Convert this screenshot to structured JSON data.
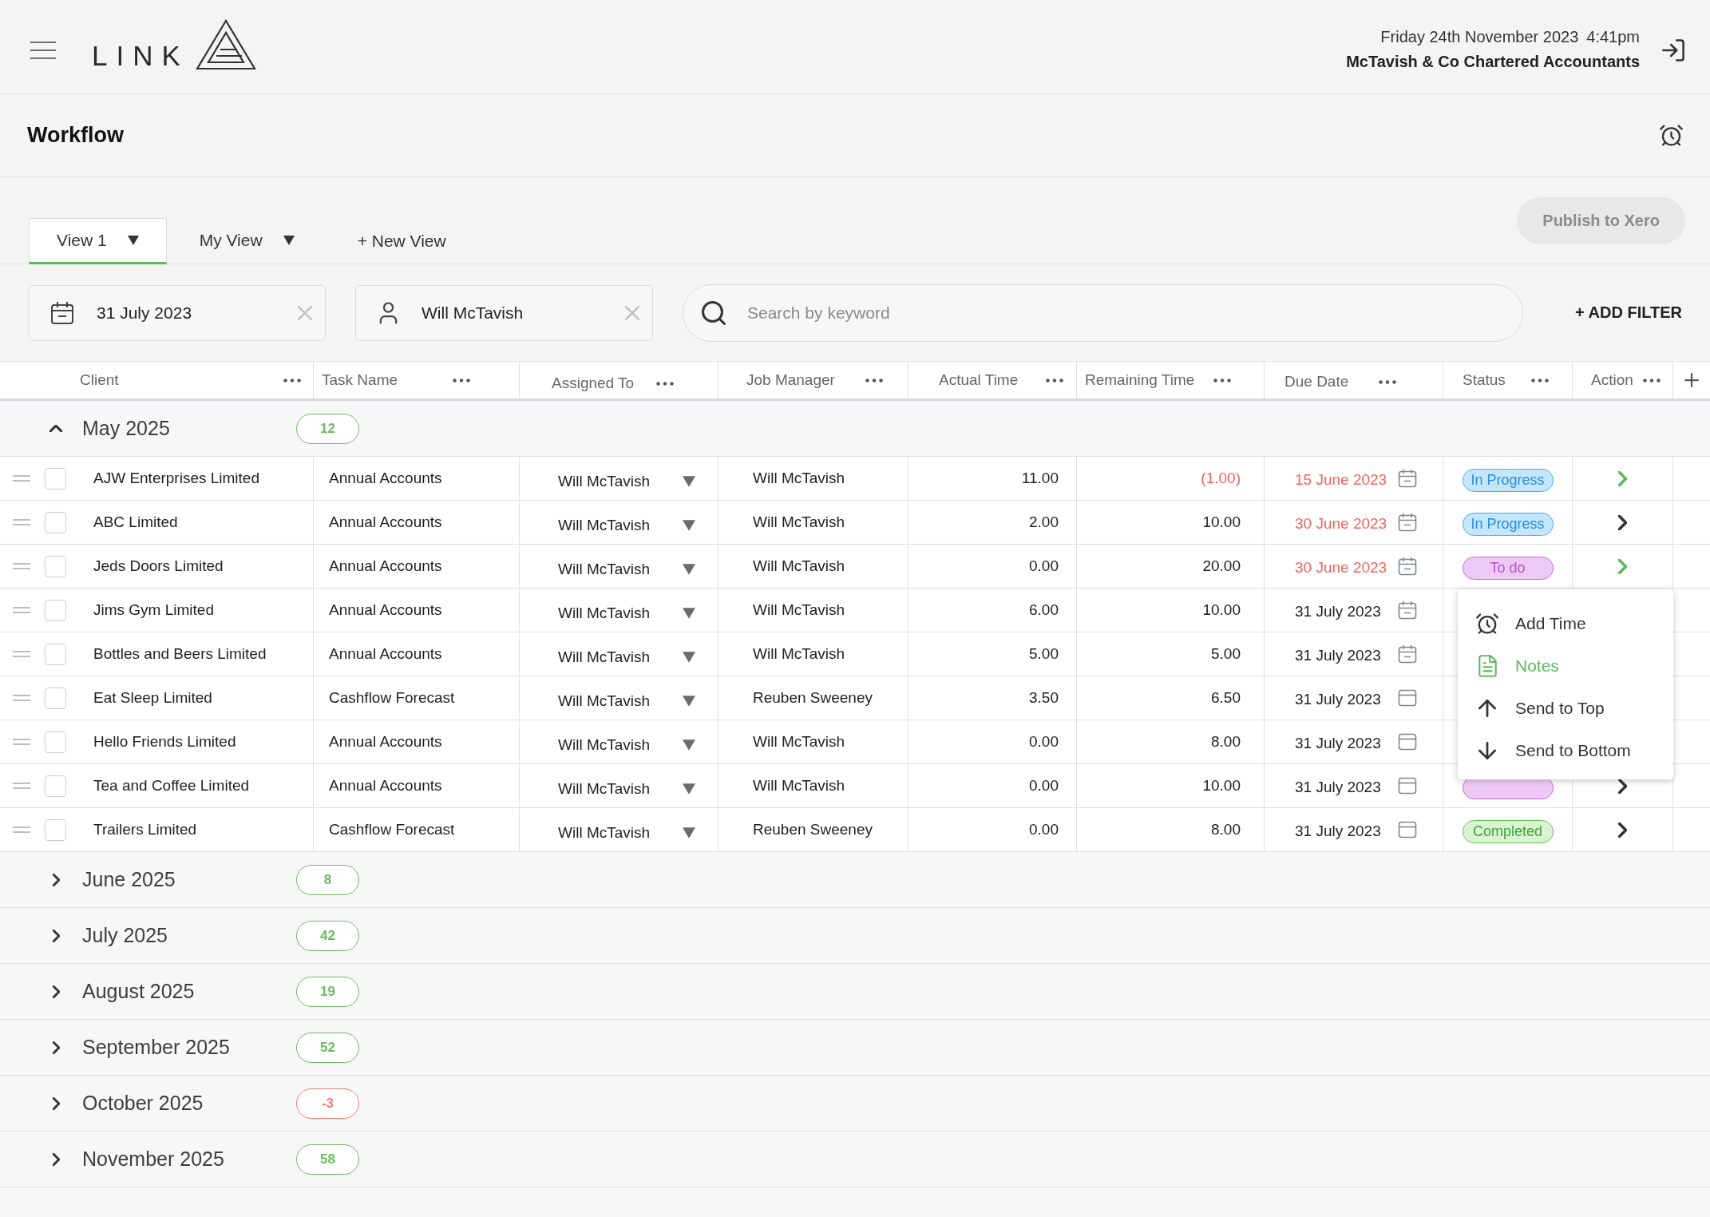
{
  "header": {
    "logo": "LINK",
    "date": "Friday 24th November 2023",
    "time": "4:41pm",
    "company": "McTavish & Co Chartered Accountants"
  },
  "page_title": "Workflow",
  "view_tabs": [
    {
      "label": "View 1",
      "selected": true
    },
    {
      "label": "My View",
      "selected": false
    }
  ],
  "new_view_button": "+ New View",
  "publish_button": {
    "label": "Publish to Xero",
    "disabled": true
  },
  "filters": {
    "date": "31 July 2023",
    "person": "Will McTavish",
    "search": {
      "placeholder": "Search by keyword"
    },
    "add_filter": "+ ADD FILTER"
  },
  "table": {
    "columns": [
      "Client",
      "Task Name",
      "Assigned To",
      "Job Manager",
      "Actual Time",
      "Remaining Time",
      "Due Date",
      "Status",
      "Action"
    ],
    "groups": [
      {
        "label": "May 2025",
        "count": "12",
        "color": "#6dbb61",
        "expanded": true,
        "rows": [
          {
            "checked": false,
            "client": "AJW Enterprises Limited",
            "task": "Annual Accounts",
            "assigned_to": "Will McTavish",
            "job_manager": "Will McTavish",
            "actual_time": "11.00",
            "remaining_time": "(1.00)",
            "remaining_negative": true,
            "due_date": "15 June 2023",
            "overdue": true,
            "calendar_lines": true,
            "status": {
              "kind": "in_progress",
              "label": "In Progress"
            },
            "action": {
              "highlighted": true
            },
            "menu_open": false
          },
          {
            "checked": false,
            "client": "ABC Limited",
            "task": "Annual Accounts",
            "assigned_to": "Will McTavish",
            "job_manager": "Will McTavish",
            "actual_time": "2.00",
            "remaining_time": "10.00",
            "remaining_negative": false,
            "due_date": "30 June 2023",
            "overdue": true,
            "calendar_lines": true,
            "status": {
              "kind": "in_progress",
              "label": "In Progress"
            },
            "action": {
              "highlighted": false
            },
            "menu_open": false
          },
          {
            "checked": false,
            "client": "Jeds Doors Limited",
            "task": "Annual Accounts",
            "assigned_to": "Will McTavish",
            "job_manager": "Will McTavish",
            "actual_time": "0.00",
            "remaining_time": "20.00",
            "remaining_negative": false,
            "due_date": "30 June 2023",
            "overdue": true,
            "calendar_lines": true,
            "status": {
              "kind": "todo",
              "label": "To do"
            },
            "action": {
              "highlighted": true
            },
            "menu_open": true
          },
          {
            "checked": false,
            "client": "Jims Gym Limited",
            "task": "Annual Accounts",
            "assigned_to": "Will McTavish",
            "job_manager": "Will McTavish",
            "actual_time": "6.00",
            "remaining_time": "10.00",
            "remaining_negative": false,
            "due_date": "31 July 2023",
            "overdue": false,
            "calendar_lines": true,
            "menu_open": false
          },
          {
            "checked": false,
            "client": "Bottles and Beers Limited",
            "task": "Annual Accounts",
            "assigned_to": "Will McTavish",
            "job_manager": "Will McTavish",
            "actual_time": "5.00",
            "remaining_time": "5.00",
            "remaining_negative": false,
            "due_date": "31 July 2023",
            "overdue": false,
            "calendar_lines": true,
            "menu_open": false
          },
          {
            "checked": false,
            "client": "Eat Sleep Limited",
            "task": "Cashflow Forecast",
            "assigned_to": "Will McTavish",
            "job_manager": "Reuben Sweeney",
            "actual_time": "3.50",
            "remaining_time": "6.50",
            "remaining_negative": false,
            "due_date": "31 July 2023",
            "overdue": false,
            "calendar_lines": false,
            "menu_open": false
          },
          {
            "checked": false,
            "client": "Hello Friends Limited",
            "task": "Annual Accounts",
            "assigned_to": "Will McTavish",
            "job_manager": "Will McTavish",
            "actual_time": "0.00",
            "remaining_time": "8.00",
            "remaining_negative": false,
            "due_date": "31 July 2023",
            "overdue": false,
            "calendar_lines": false,
            "menu_open": false
          },
          {
            "checked": false,
            "client": "Tea and Coffee Limited",
            "task": "Annual Accounts",
            "assigned_to": "Will McTavish",
            "job_manager": "Will McTavish",
            "actual_time": "0.00",
            "remaining_time": "10.00",
            "remaining_negative": false,
            "due_date": "31 July 2023",
            "overdue": false,
            "calendar_lines": false,
            "status": {
              "kind": "todo"
            },
            "action": {
              "highlighted": false
            },
            "menu_open": false
          },
          {
            "checked": false,
            "client": "Trailers Limited",
            "task": "Cashflow Forecast",
            "assigned_to": "Will McTavish",
            "job_manager": "Reuben Sweeney",
            "actual_time": "0.00",
            "remaining_time": "8.00",
            "remaining_negative": false,
            "due_date": "31 July 2023",
            "overdue": false,
            "calendar_lines": false,
            "status": {
              "kind": "completed",
              "label": "Completed"
            },
            "action": {
              "highlighted": false
            },
            "menu_open": false
          }
        ]
      },
      {
        "label": "June 2025",
        "count": "8",
        "color": "#6dbb61",
        "expanded": false
      },
      {
        "label": "July 2025",
        "count": "42",
        "color": "#6dbb61",
        "expanded": false
      },
      {
        "label": "August 2025",
        "count": "19",
        "color": "#6dbb61",
        "expanded": false
      },
      {
        "label": "September 2025",
        "count": "52",
        "color": "#6dbb61",
        "expanded": false
      },
      {
        "label": "October 2025",
        "count": "-3",
        "color": "#f27b6f",
        "expanded": false
      },
      {
        "label": "November 2025",
        "count": "58",
        "color": "#6dbb61",
        "expanded": false
      }
    ]
  },
  "context_menu": {
    "items": [
      {
        "kind": "time",
        "label": "Add Time",
        "selected": false
      },
      {
        "kind": "notes",
        "label": "Notes",
        "selected": true
      },
      {
        "kind": "up",
        "label": "Send to Top",
        "selected": false
      },
      {
        "kind": "down",
        "label": "Send to Bottom",
        "selected": false
      }
    ]
  }
}
